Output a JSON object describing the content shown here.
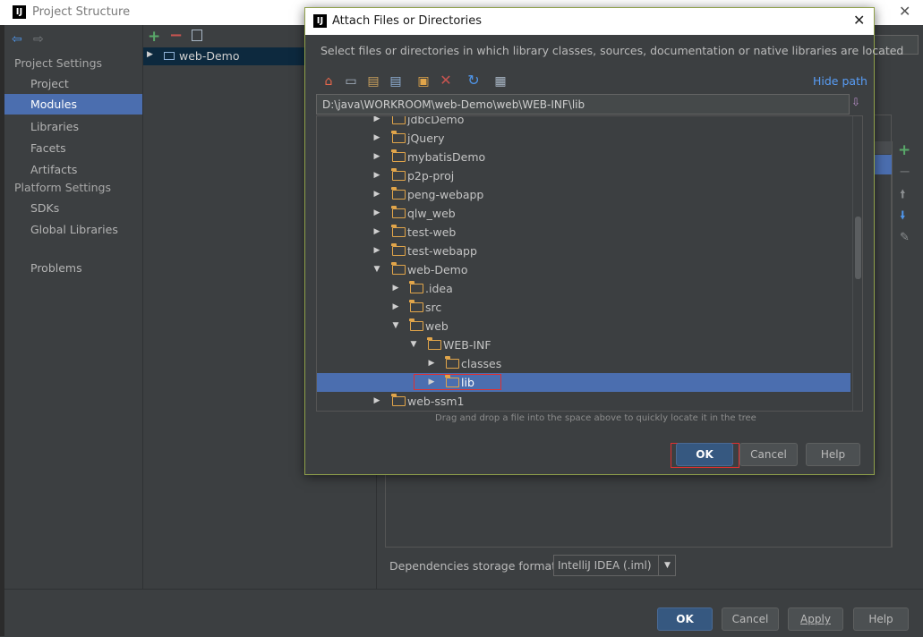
{
  "background_window": {
    "title": "Project Structure",
    "nav": {
      "project_settings_heading": "Project Settings",
      "project_settings_items": [
        "Project",
        "Modules",
        "Libraries",
        "Facets",
        "Artifacts"
      ],
      "platform_settings_heading": "Platform Settings",
      "platform_settings_items": [
        "SDKs",
        "Global Libraries"
      ],
      "problems": "Problems"
    },
    "module_tree_item": "web-Demo",
    "dependencies_format_label": "Dependencies storage format:",
    "dependencies_format_value": "IntelliJ IDEA (.iml)",
    "buttons": {
      "ok": "OK",
      "cancel": "Cancel",
      "apply": "Apply",
      "help": "Help"
    }
  },
  "dialog": {
    "title": "Attach Files or Directories",
    "description": "Select files or directories in which library classes, sources, documentation or native libraries are located",
    "hide_path": "Hide path",
    "path_value": "D:\\java\\WORKROOM\\web-Demo\\web\\WEB-INF\\lib",
    "drag_hint": "Drag and drop a file into the space above to quickly locate it in the tree",
    "tree": [
      {
        "label": "jdbcDemo",
        "expanded": false
      },
      {
        "label": "jQuery",
        "expanded": false
      },
      {
        "label": "mybatisDemo",
        "expanded": false
      },
      {
        "label": "p2p-proj",
        "expanded": false
      },
      {
        "label": "peng-webapp",
        "expanded": false
      },
      {
        "label": "qlw_web",
        "expanded": false
      },
      {
        "label": "test-web",
        "expanded": false
      },
      {
        "label": "test-webapp",
        "expanded": false
      },
      {
        "label": "web-Demo",
        "expanded": true
      },
      {
        "label": ".idea",
        "expanded": false
      },
      {
        "label": "src",
        "expanded": false
      },
      {
        "label": "web",
        "expanded": true
      },
      {
        "label": "WEB-INF",
        "expanded": true
      },
      {
        "label": "classes",
        "expanded": false
      },
      {
        "label": "lib",
        "expanded": false,
        "selected": true
      },
      {
        "label": "web-ssm1",
        "expanded": false
      }
    ],
    "buttons": {
      "ok": "OK",
      "cancel": "Cancel",
      "help": "Help"
    }
  },
  "colors": {
    "background": "#3c3f41",
    "nav_background": "#3c3f41",
    "selection": "#4b6eaf",
    "button_primary": "#365880",
    "accent_link": "#589df6",
    "folder": "#e1a54a",
    "highlight_box": "#e03030",
    "dialog_border": "#8fa04a"
  }
}
